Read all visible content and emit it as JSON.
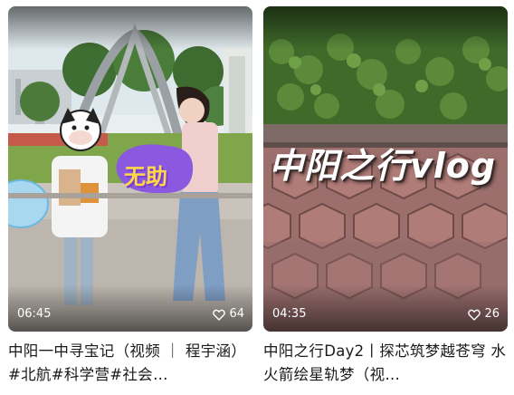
{
  "cards": [
    {
      "duration": "06:45",
      "likes": "64",
      "title": "中阳一中寻宝记（视频 ｜ 程宇涵）#北航#科学营#社会…",
      "sticker_text": "无助",
      "like_icon": "heart-outline-icon"
    },
    {
      "duration": "04:35",
      "likes": "26",
      "title": "中阳之行Day2丨探芯筑梦越苍穹 水火箭绘星轨梦（视…",
      "overlay_text": "中阳之行vlog",
      "like_icon": "heart-outline-icon"
    }
  ]
}
